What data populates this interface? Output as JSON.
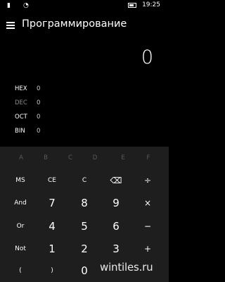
{
  "status_bar": {
    "time": "19:25",
    "signal_glyph": "▮",
    "wifi_glyph": "◔",
    "icons": [
      "signal-icon",
      "wifi-icon",
      "battery-icon"
    ]
  },
  "header": {
    "title": "Программирование",
    "menu_icon": "hamburger-menu-icon"
  },
  "display": {
    "value": "0"
  },
  "radix": [
    {
      "label": "HEX",
      "value": "0"
    },
    {
      "label": "DEC",
      "value": "0",
      "active": true
    },
    {
      "label": "OCT",
      "value": "0"
    },
    {
      "label": "BIN",
      "value": "0"
    }
  ],
  "keypad": {
    "hex_row": [
      "A",
      "B",
      "C",
      "D",
      "E",
      "F"
    ],
    "row1": [
      "MS",
      "CE",
      "C",
      "⌫",
      "÷"
    ],
    "row2": [
      "And",
      "7",
      "8",
      "9",
      "×"
    ],
    "row3": [
      "Or",
      "4",
      "5",
      "6",
      "−"
    ],
    "row4": [
      "Not",
      "1",
      "2",
      "3",
      "+"
    ],
    "row5": [
      "(",
      ")",
      "0"
    ]
  },
  "watermark": "wintiles.ru",
  "colors": {
    "background": "#000000",
    "keypad_bg": "#1e1e1e",
    "text": "#ffffff",
    "hex_disabled": "#5a5a5a"
  }
}
